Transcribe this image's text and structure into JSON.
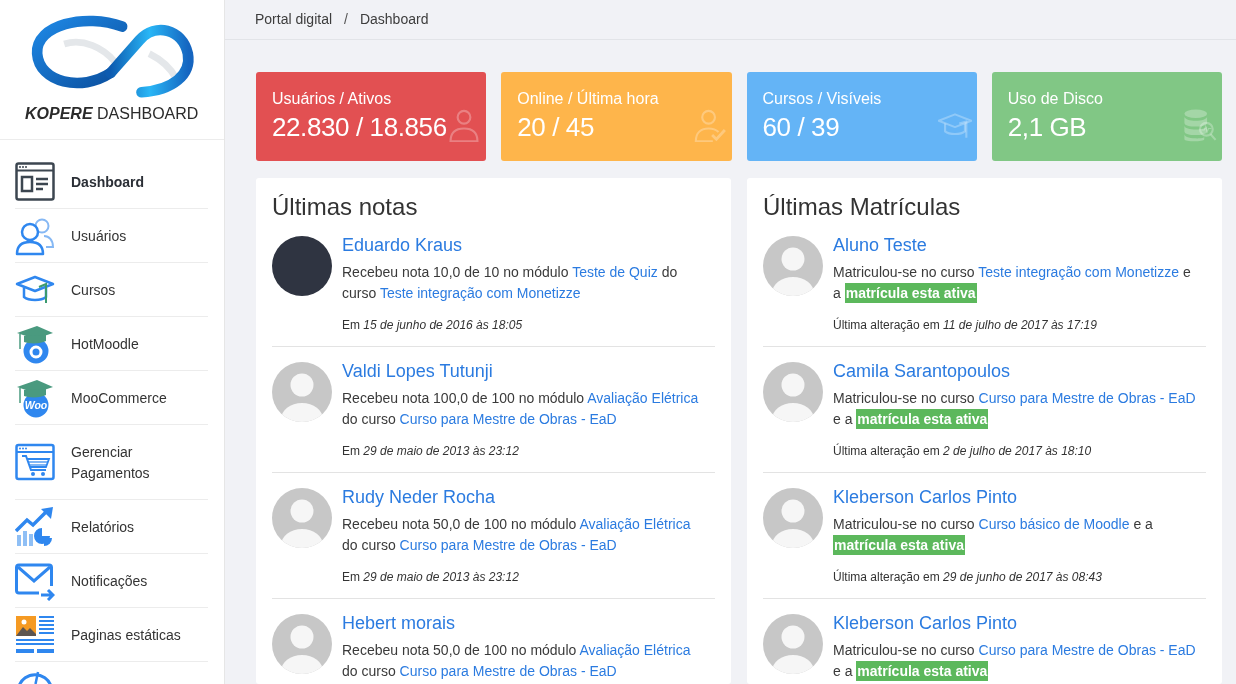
{
  "sidebar": {
    "logo": {
      "wordmark": "**KOPERE** DASHBOARD"
    },
    "items": [
      {
        "label": "Dashboard",
        "selected": true
      },
      {
        "label": "Usuários",
        "selected": false
      },
      {
        "label": "Cursos",
        "selected": false
      },
      {
        "label": "HotMoodle",
        "selected": false
      },
      {
        "label": "MooCommerce",
        "selected": false,
        "icon_text": "Woo"
      },
      {
        "label": "Gerenciar Pagamentos",
        "selected": false
      },
      {
        "label": "Relatórios",
        "selected": false
      },
      {
        "label": "Notificações",
        "selected": false
      },
      {
        "label": "Paginas estáticas",
        "selected": false
      }
    ]
  },
  "breadcrumb": {
    "items": [
      "Portal digital",
      "Dashboard"
    ],
    "separator": "/"
  },
  "stats": [
    {
      "label": "Usuários / Ativos",
      "value": "22.830 / 18.856",
      "color": "#e25052"
    },
    {
      "label": "Online / Última hora",
      "value": "20 / 45",
      "color": "#feb54b"
    },
    {
      "label": "Cursos / Visíveis",
      "value": "60 / 39",
      "color": "#64b4f6"
    },
    {
      "label": "Uso de Disco",
      "value": "2,1 GB",
      "color": "#81c785"
    }
  ],
  "panels": [
    {
      "title": "Últimas notas",
      "items": [
        {
          "photo": true,
          "name": "Eduardo Kraus",
          "message": [
            {
              "kind": "text",
              "text": "Recebeu nota 10,0 de 10 no módulo "
            },
            {
              "kind": "module",
              "text": "Teste de Quiz"
            },
            {
              "kind": "text",
              "text": " do curso "
            },
            {
              "kind": "course",
              "text": "Teste integração com Monetizze"
            }
          ],
          "date": "Em *15 de junho de 2016 às 18:05*"
        },
        {
          "photo": false,
          "name": "Valdi Lopes Tutunji",
          "message": [
            {
              "kind": "text",
              "text": "Recebeu nota 100,0 de 100 no módulo "
            },
            {
              "kind": "module",
              "text": "Avaliação Elétrica"
            },
            {
              "kind": "text",
              "text": " do curso "
            },
            {
              "kind": "course",
              "text": "Curso para Mestre de Obras - EaD"
            }
          ],
          "date": "Em *29 de maio de 2013 às 23:12*"
        },
        {
          "photo": false,
          "name": "Rudy Neder Rocha",
          "message": [
            {
              "kind": "text",
              "text": "Recebeu nota 50,0 de 100 no módulo "
            },
            {
              "kind": "module",
              "text": "Avaliação Elétrica"
            },
            {
              "kind": "text",
              "text": " do curso "
            },
            {
              "kind": "course",
              "text": "Curso para Mestre de Obras - EaD"
            }
          ],
          "date": "Em *29 de maio de 2013 às 23:12*"
        },
        {
          "photo": false,
          "name": "Hebert morais",
          "message": [
            {
              "kind": "text",
              "text": "Recebeu nota 50,0 de 100 no módulo "
            },
            {
              "kind": "module",
              "text": "Avaliação Elétrica"
            },
            {
              "kind": "text",
              "text": " do curso "
            },
            {
              "kind": "course",
              "text": "Curso para Mestre de Obras - EaD"
            }
          ]
        }
      ]
    },
    {
      "title": "Últimas Matrículas",
      "items": [
        {
          "photo": false,
          "name": "Aluno Teste",
          "message": [
            {
              "kind": "text",
              "text": "Matriculou-se no curso "
            },
            {
              "kind": "course",
              "text": "Teste integração com Monetizze"
            },
            {
              "kind": "text",
              "text": " e a "
            },
            {
              "kind": "status",
              "text": "matrícula esta ativa"
            }
          ],
          "date": "Última alteração em *11 de julho de 2017 às 17:19*"
        },
        {
          "photo": false,
          "name": "Camila Sarantopoulos",
          "message": [
            {
              "kind": "text",
              "text": "Matriculou-se no curso "
            },
            {
              "kind": "course",
              "text": "Curso para Mestre de Obras - EaD"
            },
            {
              "kind": "text",
              "text": " e a "
            },
            {
              "kind": "status",
              "text": "matrícula esta ativa"
            }
          ],
          "date": "Última alteração em *2 de julho de 2017 às 18:10*"
        },
        {
          "photo": false,
          "name": "Kleberson Carlos Pinto",
          "message": [
            {
              "kind": "text",
              "text": "Matriculou-se no curso "
            },
            {
              "kind": "course",
              "text": "Curso básico de Moodle"
            },
            {
              "kind": "text",
              "text": " e a "
            },
            {
              "kind": "status",
              "text": "matrícula esta ativa"
            }
          ],
          "date": "Última alteração em *29 de junho de 2017 às 08:43*"
        },
        {
          "photo": false,
          "name": "Kleberson Carlos Pinto",
          "message": [
            {
              "kind": "text",
              "text": "Matriculou-se no curso "
            },
            {
              "kind": "course",
              "text": "Curso para Mestre de Obras - EaD"
            },
            {
              "kind": "text",
              "text": " e a "
            },
            {
              "kind": "status",
              "text": "matrícula esta ativa"
            }
          ]
        }
      ]
    }
  ]
}
